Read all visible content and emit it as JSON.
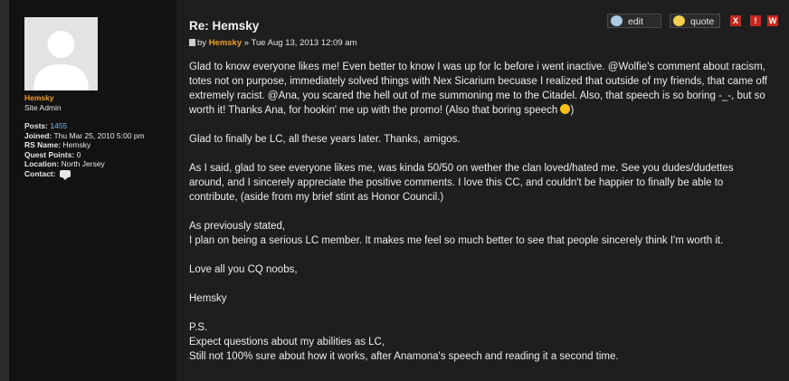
{
  "profile": {
    "username": "Hemsky",
    "rank": "Site Admin",
    "posts_label": "Posts:",
    "posts_value": "1455",
    "joined_label": "Joined:",
    "joined_value": "Thu Mar 25, 2010 5:00 pm",
    "rsname_label": "RS Name:",
    "rsname_value": "Hemsky",
    "questpoints_label": "Quest Points:",
    "questpoints_value": "0",
    "location_label": "Location:",
    "location_value": "North Jersey",
    "contact_label": "Contact:",
    "avatar_icon": "default-avatar-icon",
    "contact_icon": "speech-bubble-icon"
  },
  "post": {
    "title": "Re: Hemsky",
    "byline_prefix": "by",
    "author": "Hemsky",
    "separator": "»",
    "timestamp": "Tue Aug 13, 2013 12:09 am",
    "paragraphs": [
      "Glad to know everyone likes me! Even better to know I was up for lc before i went inactive. @Wolfie's comment about racism, totes not on purpose, immediately solved things with Nex Sicarium becuase I realized that outside of my friends, that came off extremely racist. @Ana, you scared the hell out of me summoning me to the Citadel. Also, that speech is so boring -_-, but so worth it! Thanks Ana, for hookin' me up with the promo! (Also that boring speech",
      "Glad to finally be LC, all these years later. Thanks, amigos.",
      "As I said, glad to see everyone likes me, was kinda 50/50 on wether the clan loved/hated me. See you dudes/dudettes around, and I sincerely appreciate the positive comments. I love this CC, and couldn't be happier to finally be able to contribute, (aside from my brief stint as Honor Council.)",
      "As previously stated,",
      "I plan on being a serious LC member. It makes me feel so much better to see that people sincerely think I'm worth it.",
      "Love all you CQ noobs,",
      "Hemsky",
      "P.S.",
      "Expect questions about my abilities as LC,",
      "Still not 100% sure about how it works, after Anamona's speech and reading it a second time."
    ],
    "paragraph1_tail": ")"
  },
  "actions": {
    "edit_label": "edit",
    "quote_label": "quote",
    "report_label": "X",
    "warn_label": "!",
    "info_label": "W"
  },
  "colors": {
    "author": "#f0a028",
    "link": "#7fb8e6",
    "action_red": "#c6281f"
  }
}
